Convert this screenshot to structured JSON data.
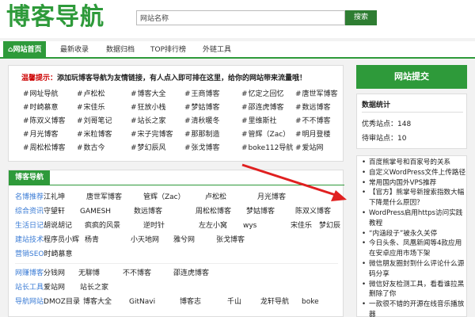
{
  "header": {
    "logo": "博客导航",
    "search_placeholder": "网站名称",
    "search_button": "搜索"
  },
  "nav": {
    "items": [
      "网站首页",
      "最新收录",
      "数据归档",
      "TOP排行榜",
      "外链工具"
    ]
  },
  "notice": {
    "prefix": "温馨提示：",
    "text": "添加玩博客导航为友情链接，有人点入即可排在这里，给你的网站带来流量哦！",
    "sites": [
      [
        "网址导航",
        "卢松松",
        "博客大全",
        "王商博客",
        "忆定之回忆",
        "唐世军博客"
      ],
      [
        "时崎慕意",
        "宋佳乐",
        "狂放小栈",
        "梦姑博客",
        "邵连虎博客",
        "数远博客"
      ],
      [
        "陈双义博客",
        "刘哥笔记",
        "站长之家",
        "清秋暖冬",
        "里维斯社",
        "不不博客"
      ],
      [
        "月光博客",
        "米粒博客",
        "宋子完博客",
        "那那制造",
        "管辉（Zac）",
        "明月登楼"
      ],
      [
        "周松松博客",
        "数古今",
        "梦幻辰风",
        "张戈博客",
        "boke112导航",
        "爱站网"
      ]
    ]
  },
  "nav_block": {
    "title": "博客导航",
    "rows": [
      {
        "cat_a": "名博推荐",
        "cat_b": "江礼坤",
        "links": [
          "唐世军博客",
          "管辉（Zac）",
          "卢松松",
          "月光博客"
        ]
      },
      {
        "cat_a": "综合资讯",
        "cat_b": "守望轩",
        "links": [
          "GAMESH",
          "数远博客",
          "周松松博客",
          "梦姑博客",
          "陈双义博客"
        ]
      },
      {
        "cat_a": "生活日记",
        "cat_b": "胡说胡记",
        "links": [
          "疯疯的风景",
          "逆时针",
          "左左小窝",
          "wys",
          "宋佳乐",
          "梦幻辰"
        ]
      },
      {
        "cat_a": "建站技术",
        "cat_b": "程序员小辉",
        "links": [
          "杨青",
          "小天地网",
          "雅兮网",
          "张戈博客"
        ]
      },
      {
        "cat_a": "营销SEO",
        "cat_b": "时崎慕意",
        "links": []
      },
      {
        "cat_a": "网赚博客",
        "cat_b": "分钱网",
        "links": [
          "无聊博",
          "不不博客",
          "邵连虎博客"
        ]
      },
      {
        "cat_a": "站长工具",
        "cat_b": "爱站网",
        "links": [
          "站长之家"
        ]
      },
      {
        "cat_a": "导航网站",
        "cat_b": "DMOZ目录",
        "links": [
          "博客大全",
          "GitNavi",
          "博客志",
          "千山",
          "龙轩导航",
          "boke"
        ]
      }
    ]
  },
  "sidebar": {
    "submit_title": "网站提交",
    "stats_title": "数据统计",
    "stats": [
      "优秀站点：148",
      "待审站点：10"
    ],
    "news": [
      "百度熊掌号和百家号的关系",
      "自定义WordPress文件上传路径",
      "常用国内国外VPS推荐",
      "【官方】熊掌号新搜索指数大幅下降是什么原因？",
      "WordPress启用https访问实践教程",
      "“内涵段子”被永久关停",
      "今日头条、凤凰新闻等4款应用在安卓应用市场下架",
      "微信朋友圈封到什么评论什么源码分享",
      "微信好友检测工具，看看谁拉黑删除了你",
      "一款很不错的开源在线音乐播放器"
    ]
  },
  "colors": {
    "accent": "#2e9a3a",
    "link_blue": "#3a7bd5",
    "arrow_red": "#e02020"
  }
}
